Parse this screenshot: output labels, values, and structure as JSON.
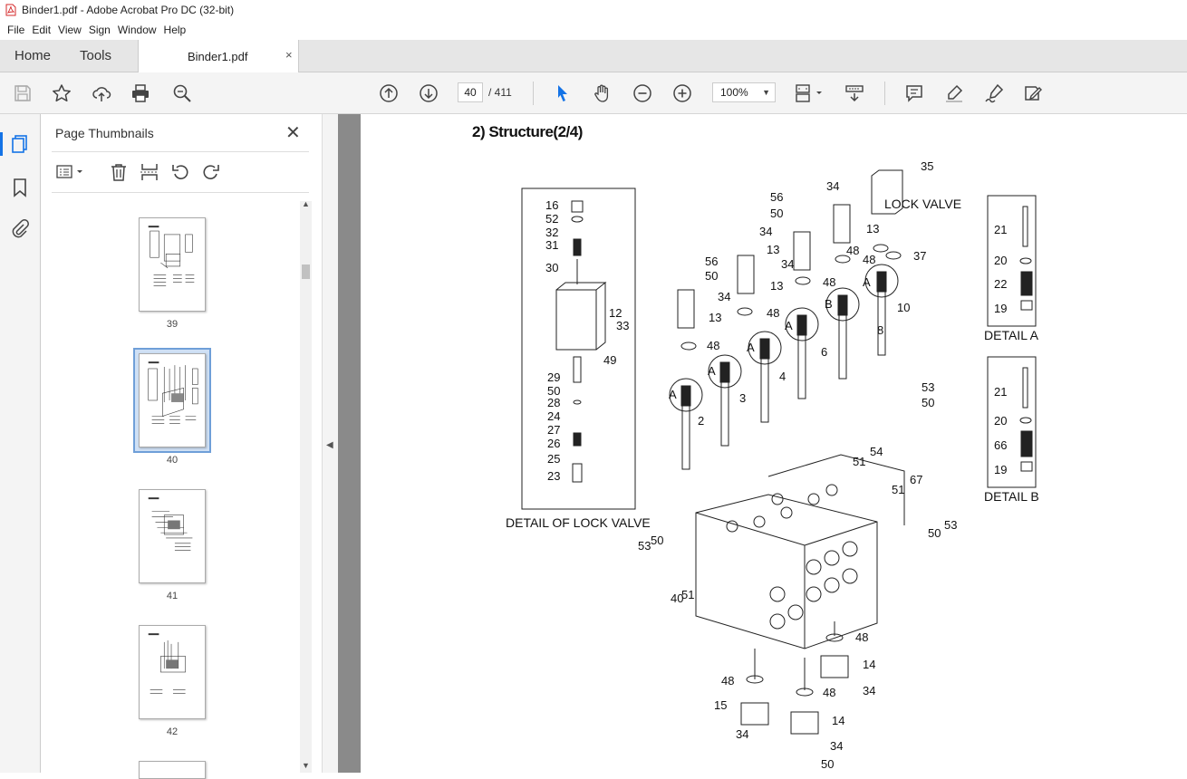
{
  "window": {
    "title": "Binder1.pdf - Adobe Acrobat Pro DC (32-bit)"
  },
  "menu": [
    "File",
    "Edit",
    "View",
    "Sign",
    "Window",
    "Help"
  ],
  "tabs": {
    "home": "Home",
    "tools": "Tools",
    "document": "Binder1.pdf",
    "close": "×"
  },
  "toolbar": {
    "current_page": "40",
    "total_pages": "/ 411",
    "zoom": "100%",
    "icons": [
      "save-icon",
      "bookmark-star-icon",
      "upload-icon",
      "print-icon",
      "search-zoom-icon",
      "page-up-icon",
      "page-down-icon",
      "select-pointer-icon",
      "hand-icon",
      "zoom-out-icon",
      "zoom-in-icon",
      "page-fit-icon",
      "scroll-mode-icon",
      "comment-icon",
      "highlight-icon",
      "sign-icon",
      "more-tools-icon"
    ]
  },
  "sidebar": {
    "title": "Page Thumbnails",
    "close": "✕",
    "thumbnails": [
      {
        "page": "39"
      },
      {
        "page": "40",
        "selected": true
      },
      {
        "page": "41"
      },
      {
        "page": "42"
      }
    ]
  },
  "document": {
    "heading": "2) Structure(2/4)",
    "callouts": {
      "lock_detail": [
        "16",
        "52",
        "32",
        "31",
        "30",
        "12",
        "33",
        "49",
        "29",
        "50",
        "28",
        "24",
        "27",
        "26",
        "25",
        "23"
      ],
      "detail_a": [
        "21",
        "20",
        "22",
        "19"
      ],
      "detail_b": [
        "21",
        "20",
        "66",
        "19"
      ]
    },
    "labels": {
      "lock_detail_caption": "DETAIL OF LOCK VALVE",
      "lock_valve": "LOCK VALVE",
      "detail_a": "DETAIL A",
      "detail_b": "DETAIL B"
    }
  },
  "colors": {
    "accent": "#1473e6",
    "doc_bg": "#8a8a8a",
    "panel_selected": "#cfe0f5"
  }
}
